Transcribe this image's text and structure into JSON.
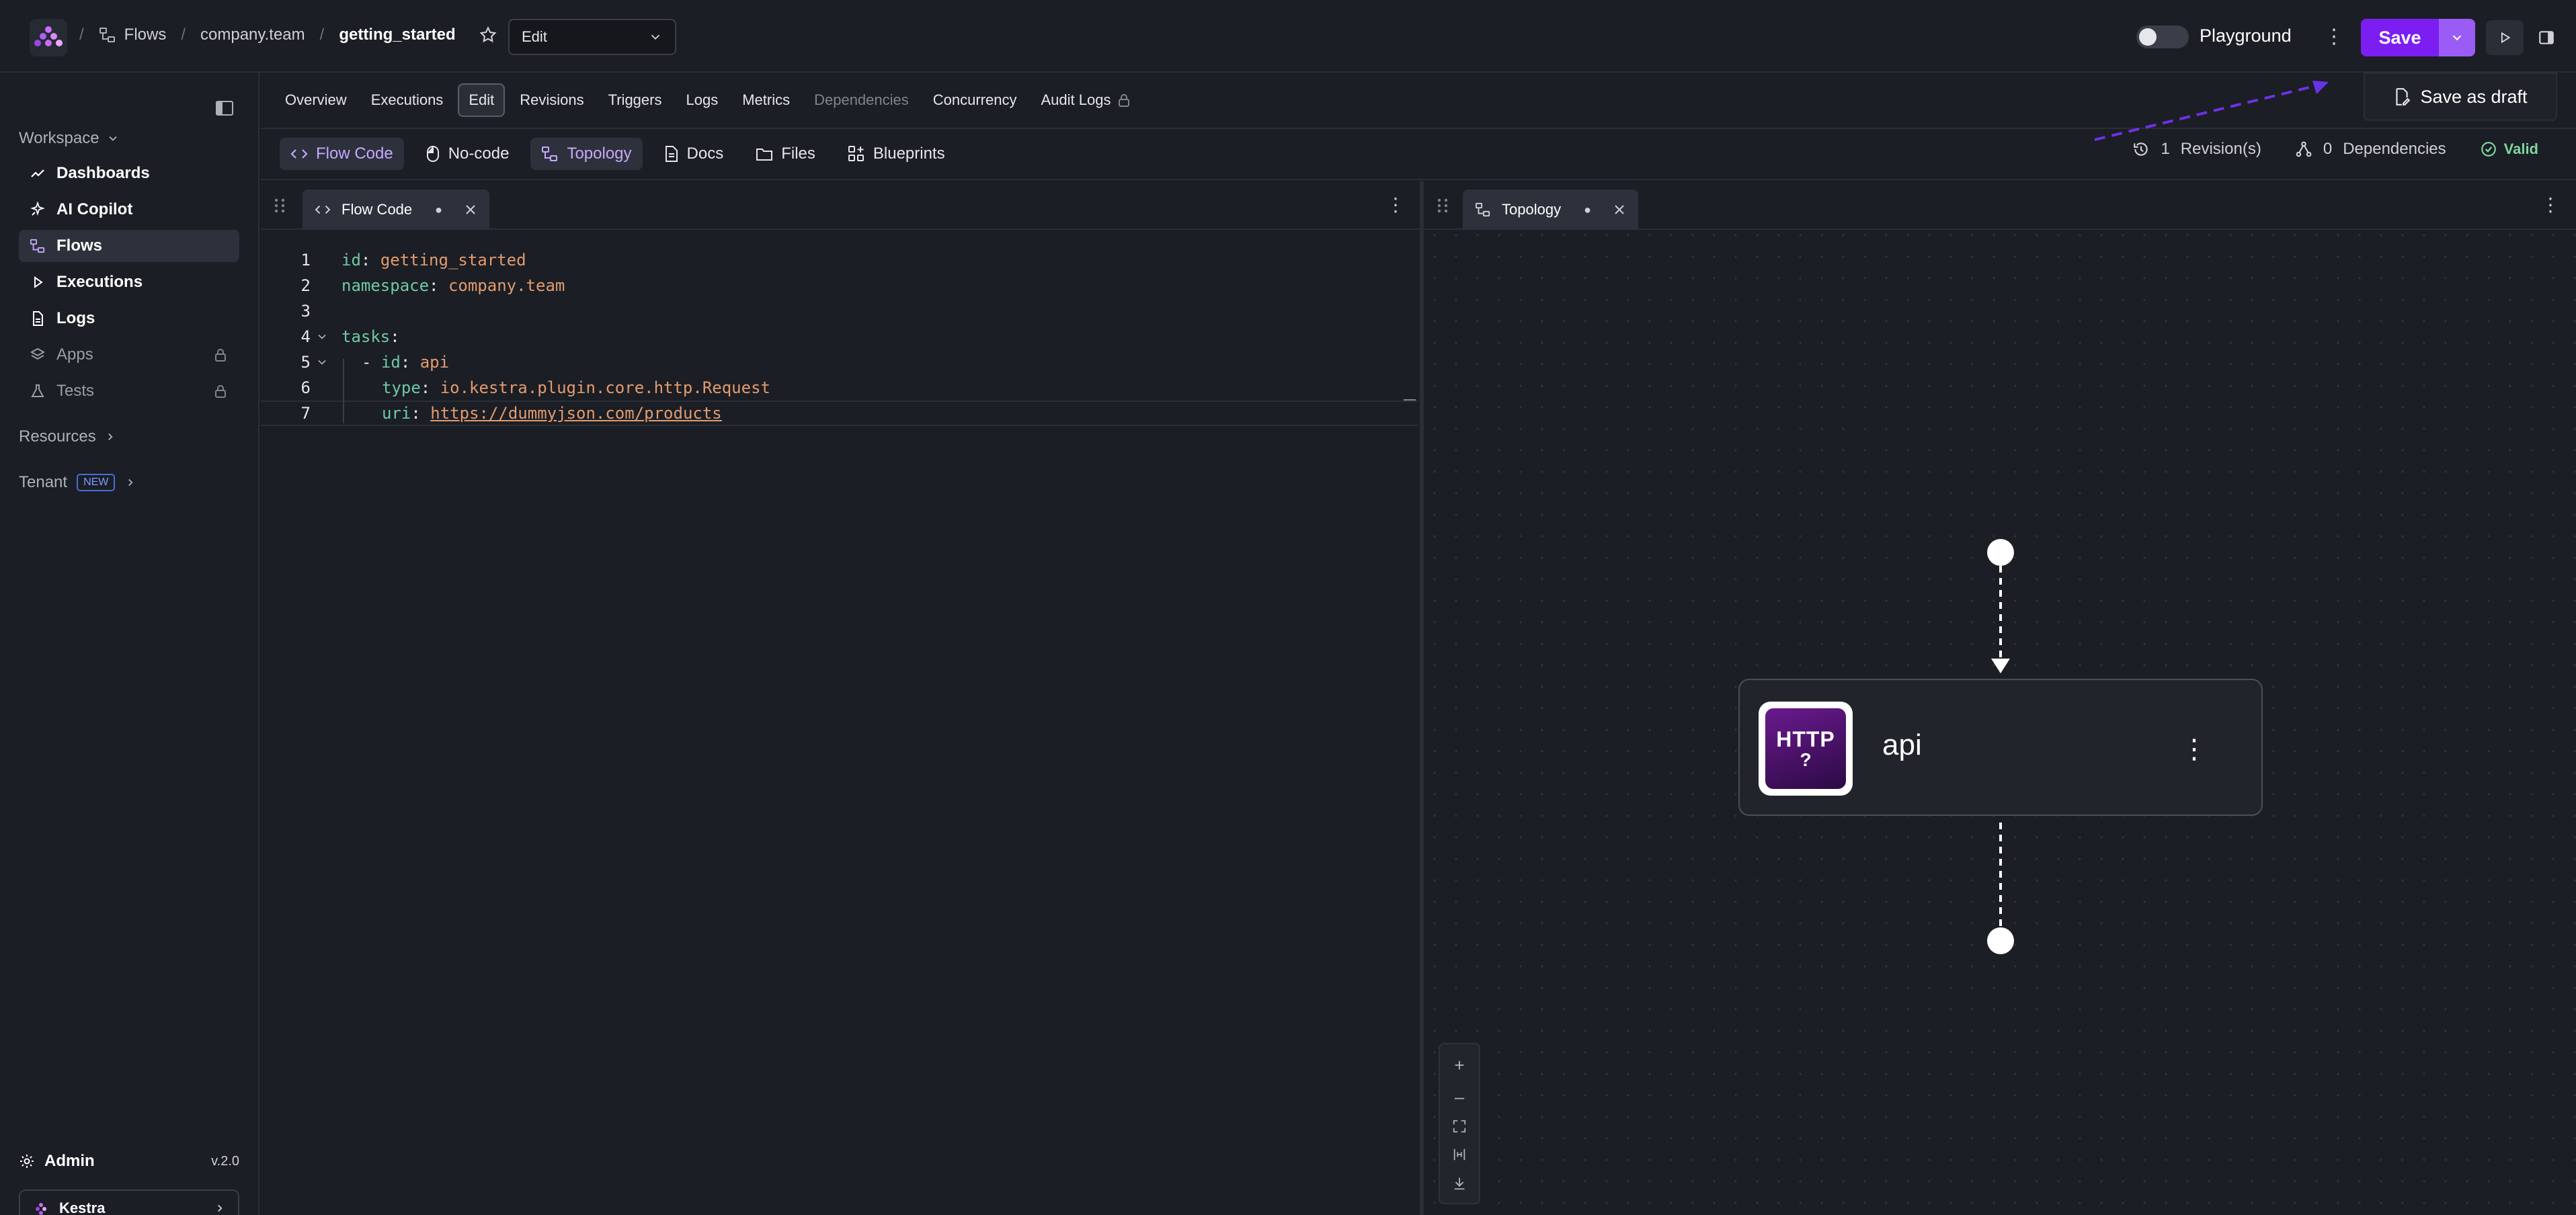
{
  "header": {
    "breadcrumb": [
      "Flows",
      "company.team"
    ],
    "current": "getting_started",
    "mode_select": "Edit",
    "playground_label": "Playground",
    "save_label": "Save",
    "save_as_draft_label": "Save as draft"
  },
  "sidebar": {
    "workspace_label": "Workspace",
    "items": [
      {
        "label": "Dashboards",
        "icon": "chart-line-icon",
        "active": false,
        "locked": false
      },
      {
        "label": "AI Copilot",
        "icon": "sparkle-icon",
        "active": false,
        "locked": false
      },
      {
        "label": "Flows",
        "icon": "flow-icon",
        "active": true,
        "locked": false
      },
      {
        "label": "Executions",
        "icon": "play-icon",
        "active": false,
        "locked": false
      },
      {
        "label": "Logs",
        "icon": "file-icon",
        "active": false,
        "locked": false
      },
      {
        "label": "Apps",
        "icon": "layers-icon",
        "active": false,
        "locked": true
      },
      {
        "label": "Tests",
        "icon": "flask-icon",
        "active": false,
        "locked": true
      }
    ],
    "resources_label": "Resources",
    "tenant_label": "Tenant",
    "tenant_badge": "NEW",
    "admin_label": "Admin",
    "version": "v.2.0",
    "tenant_card_label": "Kestra"
  },
  "flow_tabs": [
    {
      "label": "Overview",
      "active": false,
      "disabled": false
    },
    {
      "label": "Executions",
      "active": false,
      "disabled": false
    },
    {
      "label": "Edit",
      "active": true,
      "disabled": false
    },
    {
      "label": "Revisions",
      "active": false,
      "disabled": false
    },
    {
      "label": "Triggers",
      "active": false,
      "disabled": false
    },
    {
      "label": "Logs",
      "active": false,
      "disabled": false
    },
    {
      "label": "Metrics",
      "active": false,
      "disabled": false
    },
    {
      "label": "Dependencies",
      "active": false,
      "disabled": true
    },
    {
      "label": "Concurrency",
      "active": false,
      "disabled": false
    },
    {
      "label": "Audit Logs",
      "active": false,
      "disabled": false
    }
  ],
  "editor_toolbar": {
    "buttons": [
      {
        "label": "Flow Code",
        "icon": "code-icon",
        "active": true
      },
      {
        "label": "No-code",
        "icon": "mouse-icon",
        "active": false
      },
      {
        "label": "Topology",
        "icon": "topology-icon",
        "active": true
      },
      {
        "label": "Docs",
        "icon": "doc-icon",
        "active": false
      },
      {
        "label": "Files",
        "icon": "folder-icon",
        "active": false
      },
      {
        "label": "Blueprints",
        "icon": "blueprint-icon",
        "active": false
      }
    ],
    "revisions_count": "1",
    "revisions_label": "Revision(s)",
    "dependencies_count": "0",
    "dependencies_label": "Dependencies",
    "valid_label": "Valid"
  },
  "code_panel": {
    "tab_label": "Flow Code",
    "lines": [
      {
        "n": "1",
        "key": "id",
        "value": "getting_started"
      },
      {
        "n": "2",
        "key": "namespace",
        "value": "company.team"
      },
      {
        "n": "3"
      },
      {
        "n": "4",
        "key": "tasks"
      },
      {
        "n": "5",
        "key": "id",
        "value": "api"
      },
      {
        "n": "6",
        "key": "type",
        "value": "io.kestra.plugin.core.http.Request"
      },
      {
        "n": "7",
        "key": "uri",
        "value": "https://dummyjson.com/products"
      }
    ]
  },
  "topology_panel": {
    "tab_label": "Topology",
    "node": {
      "label": "api",
      "icon_text": "HTTP",
      "icon_sub": "?"
    }
  },
  "colors": {
    "accent": "#7c1ef2",
    "accent_light": "#9b5cf5",
    "valid": "#7fd6a1",
    "yaml_key": "#6ec9a5",
    "yaml_value": "#e39b6e"
  }
}
